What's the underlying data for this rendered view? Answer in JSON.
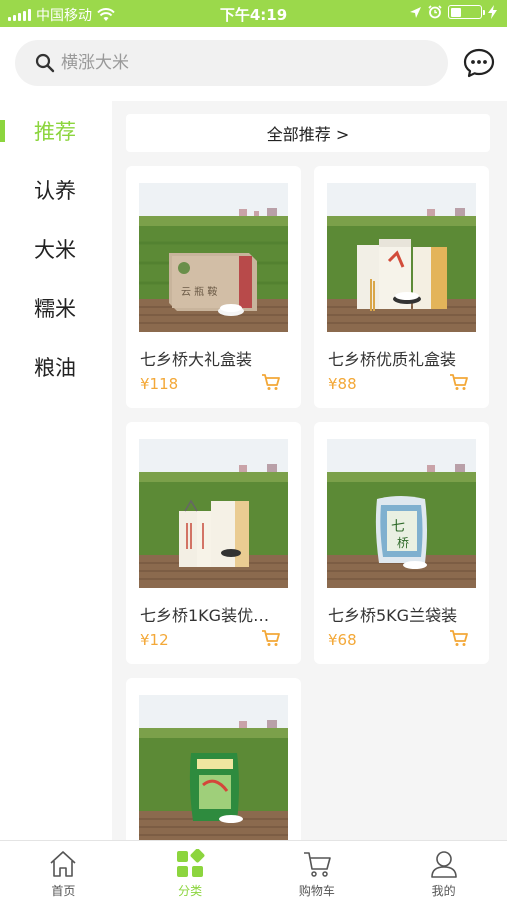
{
  "status_bar": {
    "carrier": "中国移动",
    "time": "下午4:19"
  },
  "search": {
    "placeholder": "横涨大米"
  },
  "categories": [
    {
      "label": "推荐",
      "active": true
    },
    {
      "label": "认养",
      "active": false
    },
    {
      "label": "大米",
      "active": false
    },
    {
      "label": "糯米",
      "active": false
    },
    {
      "label": "粮油",
      "active": false
    }
  ],
  "all_recommend": {
    "label": "全部推荐 >"
  },
  "products": [
    {
      "name": "七乡桥大礼盒装",
      "price": "¥118",
      "image": "gift-box"
    },
    {
      "name": "七乡桥优质礼盒装",
      "price": "¥88",
      "image": "gift-set"
    },
    {
      "name": "七乡桥1KG装优…",
      "price": "¥12",
      "image": "two-boxes"
    },
    {
      "name": "七乡桥5KG兰袋装",
      "price": "¥68",
      "image": "blue-bag"
    },
    {
      "name": "",
      "price": "",
      "image": "green-bag"
    }
  ],
  "tabbar": [
    {
      "label": "首页",
      "icon": "home-icon",
      "active": false
    },
    {
      "label": "分类",
      "icon": "category-icon",
      "active": true
    },
    {
      "label": "购物车",
      "icon": "cart-icon",
      "active": false
    },
    {
      "label": "我的",
      "icon": "user-icon",
      "active": false
    }
  ],
  "colors": {
    "accent": "#8cd53e",
    "price": "#f3a838",
    "status_bar": "#9bd94b"
  }
}
